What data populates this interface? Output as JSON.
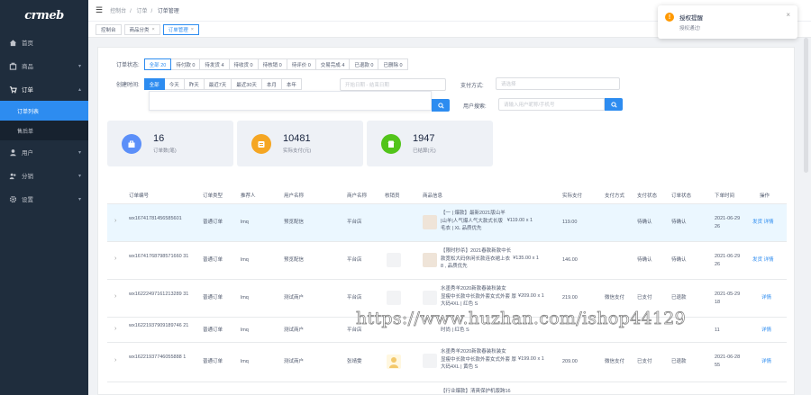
{
  "logo": "crmeb",
  "sidebar": {
    "items": [
      {
        "label": "首页",
        "icon": "home-icon"
      },
      {
        "label": "商品",
        "icon": "goods-icon"
      },
      {
        "label": "订单",
        "icon": "order-icon"
      },
      {
        "label": "用户",
        "icon": "user-icon"
      },
      {
        "label": "分销",
        "icon": "distribution-icon"
      },
      {
        "label": "设置",
        "icon": "settings-icon"
      }
    ],
    "subitems": [
      {
        "label": "订单列表"
      },
      {
        "label": "售后单"
      }
    ]
  },
  "header": {
    "breadcrumbs": [
      "控制台",
      "订单",
      "订单管理"
    ]
  },
  "tabs": [
    {
      "label": "控制台"
    },
    {
      "label": "商品分类"
    },
    {
      "label": "订单管理"
    }
  ],
  "filters": {
    "status_label": "订单状态:",
    "status_options": [
      "全部 20",
      "待付款 0",
      "待发货 4",
      "待收货 0",
      "待核销 0",
      "待评价 0",
      "交易完成 4",
      "已退款 0",
      "已删除 0"
    ],
    "time_label": "创建时间:",
    "time_options": [
      "全部",
      "今天",
      "昨天",
      "最近7天",
      "最近30天",
      "本月",
      "本年"
    ],
    "date_placeholder": "开始日期 - 结束日期",
    "payment_label": "支付方式:",
    "payment_placeholder": "请选择",
    "search_label": "用户搜索:",
    "search_placeholder": "请输入用户昵称/手机号"
  },
  "stats": [
    {
      "value": "16",
      "caption": "订单数(笔)",
      "color": "#5b8ff9"
    },
    {
      "value": "10481",
      "caption": "实际支付(元)",
      "color": "#f5a623"
    },
    {
      "value": "1947",
      "caption": "已结算(元)",
      "color": "#52c41a"
    }
  ],
  "table": {
    "headers": [
      "订单编号",
      "订单类型",
      "推荐人",
      "用户名称",
      "商户名称",
      "核销员",
      "商品信息",
      "实际支付",
      "支付方式",
      "支付状态",
      "订单状态",
      "下单时间",
      "操作"
    ],
    "rows": [
      {
        "order_no": "wx16741781456585601",
        "type": "普通订单",
        "referrer": "lmq",
        "user": "预览配信",
        "merchant": "平台店",
        "goods": "【一 | 爆款】最新2021版山羊\n|山羊|人气爆人气大款式长版\n毛衣 | XL 品质优先",
        "goods_price": "¥119.00 x 1",
        "paid": "119.00",
        "pay_method": "",
        "pay_status": "待确认",
        "order_status": "待确认",
        "time": "2021-06-29\n26",
        "actions": "发货 详情"
      },
      {
        "order_no": "wx16741768798571660 31",
        "type": "普通订单",
        "referrer": "lmq",
        "user": "预览配信",
        "merchant": "平台店",
        "goods": "【限时秒杀】2021春款新款中长\n款宽松大码休闲长款连衣裙上衣\n8 , 品质优先",
        "goods_price": "¥135.00 x 1",
        "paid": "146.00",
        "pay_method": "",
        "pay_status": "待确认",
        "order_status": "待确认",
        "time": "2021-06-29\n26",
        "actions": "发货 详情"
      },
      {
        "order_no": "wx16222497161213289 31",
        "type": "普通订单",
        "referrer": "lmq",
        "user": "测试商户",
        "merchant": "平台店",
        "goods": "水墨秀羊2020新款春装秋装女\n显瘦中长款中长款外套女式外套 厚\n大码4XL | 红色 S",
        "goods_price": "¥209.00 x 1",
        "paid": "219.00",
        "pay_method": "微信支付",
        "pay_status": "已支付",
        "order_status": "已退款",
        "time": "2021-05-29\n18",
        "actions": "详情"
      },
      {
        "order_no": "wx16221937909189746 21",
        "type": "普通订单",
        "referrer": "lmq",
        "user": "测试商户",
        "merchant": "平台店",
        "goods": "时尚 | 红色 S",
        "goods_price": "",
        "paid": "",
        "pay_method": "",
        "pay_status": "",
        "order_status": "",
        "time": "11",
        "actions": "详情"
      },
      {
        "order_no": "wx16221937746055888 1",
        "type": "普通订单",
        "referrer": "lmq",
        "user": "测试商户",
        "merchant": "张靖雯",
        "goods": "水墨秀羊2020新款春装秋装女\n显瘦中长款中长款外套女式外套 厚\n大码4XL | 黄色 S",
        "goods_price": "¥199.00 x 1",
        "paid": "209.00",
        "pay_method": "微信支付",
        "pay_status": "已支付",
        "order_status": "已退款",
        "time": "2021-06-28\n55",
        "actions": "详情"
      },
      {
        "order_no": "",
        "type": "",
        "referrer": "",
        "user": "",
        "merchant": "",
        "goods": "【行业爆款】清爽保护机版跨16",
        "goods_price": "",
        "paid": "",
        "pay_method": "",
        "pay_status": "",
        "order_status": "",
        "time": "",
        "actions": ""
      }
    ]
  },
  "notification": {
    "title": "授权提醒",
    "desc": "授权通过!",
    "color": "#ff9900"
  },
  "watermark": "https://www.huzhan.com/ishop44129"
}
